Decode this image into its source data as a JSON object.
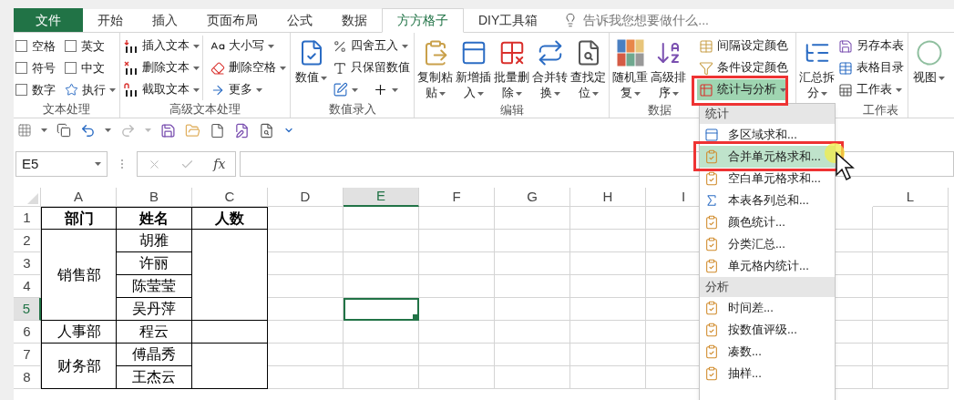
{
  "tabs": [
    {
      "label": "文件",
      "kind": "file",
      "selected": false
    },
    {
      "label": "开始",
      "kind": "tab",
      "selected": false
    },
    {
      "label": "插入",
      "kind": "tab",
      "selected": false
    },
    {
      "label": "页面布局",
      "kind": "tab",
      "selected": false
    },
    {
      "label": "公式",
      "kind": "tab",
      "selected": false
    },
    {
      "label": "数据",
      "kind": "tab",
      "selected": false
    },
    {
      "label": "方方格子",
      "kind": "tab",
      "selected": true
    },
    {
      "label": "DIY工具箱",
      "kind": "tab",
      "selected": false
    }
  ],
  "tell_me": {
    "placeholder": "告诉我您想要做什么..."
  },
  "ribbon": [
    {
      "label": "文本处理",
      "items": [
        {
          "kind": "checks",
          "options": [
            {
              "label": "空格",
              "checked": false
            },
            {
              "label": "英文",
              "checked": false
            },
            {
              "label": "符号",
              "checked": false
            },
            {
              "label": "中文",
              "checked": false
            },
            {
              "label": "数字",
              "checked": false
            }
          ],
          "run": {
            "label": "执行",
            "menu": true
          }
        }
      ]
    },
    {
      "label": "高级文本处理",
      "items": [
        {
          "kind": "stack",
          "buttons": [
            {
              "kind": "button",
              "label": "插入文本",
              "menu": true,
              "active": false
            },
            {
              "kind": "button",
              "label": "删除文本",
              "menu": true,
              "active": false
            },
            {
              "kind": "button",
              "label": "截取文本",
              "menu": true,
              "active": false
            }
          ]
        },
        {
          "kind": "stack",
          "buttons": [
            {
              "kind": "button",
              "label": "大小写",
              "menu": true,
              "active": false
            },
            {
              "kind": "button",
              "label": "删除空格",
              "menu": true,
              "active": false
            },
            {
              "kind": "button",
              "label": "更多",
              "menu": true,
              "active": false
            }
          ]
        }
      ]
    },
    {
      "label": "数值录入",
      "items": [
        {
          "kind": "large",
          "label": "数值",
          "menu": true
        },
        {
          "kind": "stack",
          "buttons": [
            {
              "kind": "button",
              "label": "四舍五入",
              "menu": true,
              "active": false
            },
            {
              "kind": "button",
              "label": "只保留数值",
              "menu": false,
              "active": false
            },
            {
              "kind": "icon_pair",
              "menus": [
                true,
                true
              ]
            }
          ]
        }
      ]
    },
    {
      "label": "编辑",
      "items": [
        {
          "kind": "large",
          "label": "复制粘贴",
          "menu": true
        },
        {
          "kind": "large",
          "label": "新增插入",
          "menu": true
        },
        {
          "kind": "large",
          "label": "批量删除",
          "menu": true
        },
        {
          "kind": "large",
          "label": "合并转换",
          "menu": true
        },
        {
          "kind": "large",
          "label": "查找定位",
          "menu": true
        }
      ]
    },
    {
      "label": "数据",
      "items": [
        {
          "kind": "large",
          "label": "随机重复",
          "menu": true
        },
        {
          "kind": "large",
          "label": "高级排序",
          "menu": true
        },
        {
          "kind": "stack",
          "buttons": [
            {
              "kind": "button",
              "label": "间隔设定颜色",
              "menu": false,
              "active": false,
              "annotated": false
            },
            {
              "kind": "button",
              "label": "条件设定颜色",
              "menu": false,
              "active": false,
              "annotated": false
            },
            {
              "kind": "button",
              "label": "统计与分析",
              "menu": true,
              "active": true,
              "annotated": true
            }
          ]
        }
      ]
    },
    {
      "label": "工作表",
      "items": [
        {
          "kind": "large",
          "label": "汇总拆分",
          "menu": true
        },
        {
          "kind": "stack",
          "buttons": [
            {
              "kind": "button",
              "label": "另存本表",
              "menu": false,
              "active": false
            },
            {
              "kind": "button",
              "label": "表格目录",
              "menu": false,
              "active": false
            },
            {
              "kind": "button",
              "label": "工作表",
              "menu": true,
              "active": false
            }
          ]
        }
      ]
    },
    {
      "items": [
        {
          "kind": "large",
          "label": "视图",
          "menu": true
        }
      ]
    }
  ],
  "dropdown_menu": [
    {
      "title": "统计",
      "items": [
        {
          "label": "多区域求和...",
          "selected": false,
          "annotated": false
        },
        {
          "label": "合并单元格求和...",
          "selected": true,
          "annotated": true
        },
        {
          "label": "空白单元格求和...",
          "selected": false,
          "annotated": false
        },
        {
          "label": "本表各列总和...",
          "selected": false,
          "annotated": false
        },
        {
          "label": "颜色统计...",
          "selected": false,
          "annotated": false
        },
        {
          "label": "分类汇总...",
          "selected": false,
          "annotated": false
        },
        {
          "label": "单元格内统计...",
          "selected": false,
          "annotated": false
        }
      ]
    },
    {
      "title": "分析",
      "items": [
        {
          "label": "时间差...",
          "selected": false,
          "annotated": false
        },
        {
          "label": "按数值评级...",
          "selected": false,
          "annotated": false
        },
        {
          "label": "凑数...",
          "selected": false,
          "annotated": false
        },
        {
          "label": "抽样...",
          "selected": false,
          "annotated": false
        }
      ]
    }
  ],
  "formula_bar": {
    "name_box": "E5",
    "function_label": "fx"
  },
  "sheet": {
    "columns": [
      {
        "label": "A",
        "selected": false,
        "cells": [
          {
            "kind": "text",
            "text": "部门",
            "bold": true
          },
          {
            "kind": "text",
            "text": "销售部",
            "bold": false
          },
          {
            "kind": "merged"
          },
          {
            "kind": "merged"
          },
          {
            "kind": "merged"
          },
          {
            "kind": "text",
            "text": "人事部",
            "bold": false
          },
          {
            "kind": "text",
            "text": "财务部",
            "bold": false
          },
          {
            "kind": "merged"
          }
        ]
      },
      {
        "label": "B",
        "selected": false,
        "cells": [
          {
            "kind": "text",
            "text": "姓名",
            "bold": true
          },
          {
            "kind": "text",
            "text": "胡雅",
            "bold": false
          },
          {
            "kind": "text",
            "text": "许丽",
            "bold": false
          },
          {
            "kind": "text",
            "text": "陈莹莹",
            "bold": false
          },
          {
            "kind": "text",
            "text": "吴丹萍",
            "bold": false
          },
          {
            "kind": "text",
            "text": "程云",
            "bold": false
          },
          {
            "kind": "text",
            "text": "傅晶秀",
            "bold": false
          },
          {
            "kind": "text",
            "text": "王杰云",
            "bold": false
          }
        ]
      },
      {
        "label": "C",
        "selected": false,
        "cells": [
          {
            "kind": "text",
            "text": "人数",
            "bold": true
          },
          {
            "kind": "blank"
          },
          {
            "kind": "merged"
          },
          {
            "kind": "merged"
          },
          {
            "kind": "merged"
          },
          {
            "kind": "blank"
          },
          {
            "kind": "blank"
          },
          {
            "kind": "merged"
          }
        ]
      },
      {
        "label": "D",
        "selected": false
      },
      {
        "label": "E",
        "selected": true
      },
      {
        "label": "F",
        "selected": false
      },
      {
        "label": "G",
        "selected": false
      },
      {
        "label": "H",
        "selected": false
      },
      {
        "label": "I",
        "selected": false
      },
      {
        "label": "L",
        "selected": false
      }
    ],
    "rows": [
      {
        "number": "1",
        "selected": false
      },
      {
        "number": "2",
        "selected": false
      },
      {
        "number": "3",
        "selected": false
      },
      {
        "number": "4",
        "selected": false
      },
      {
        "number": "5",
        "selected": true
      },
      {
        "number": "6",
        "selected": false
      },
      {
        "number": "7",
        "selected": false
      },
      {
        "number": "8",
        "selected": false
      }
    ]
  }
}
